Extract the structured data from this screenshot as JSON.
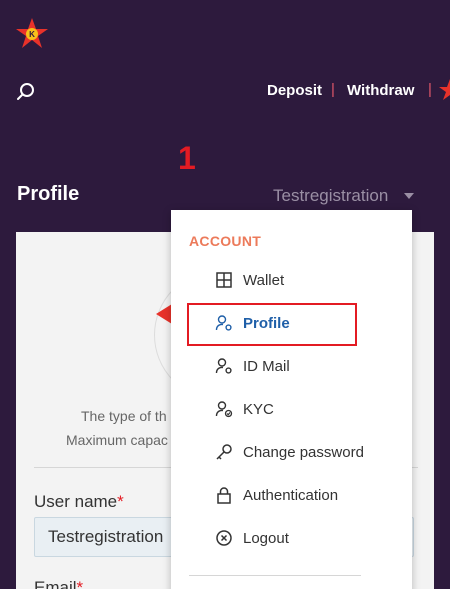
{
  "header": {
    "deposit_label": "Deposit",
    "separator": "|",
    "withdraw_label": "Withdraw"
  },
  "annotation": {
    "step_number": "1"
  },
  "page": {
    "title": "Profile"
  },
  "user_menu": {
    "selected_user": "Testregistration"
  },
  "profile_card": {
    "info_line_1": "The type of th",
    "info_line_2": "Maximum capac",
    "username_label": "User name",
    "username_value": "Testregistration",
    "email_label": "Email",
    "required_mark": "*"
  },
  "dropdown": {
    "heading": "ACCOUNT",
    "items": [
      {
        "label": "Wallet",
        "icon": "wallet-grid-icon"
      },
      {
        "label": "Profile",
        "icon": "user-gear-icon",
        "active": true
      },
      {
        "label": "ID Mail",
        "icon": "user-gear-icon"
      },
      {
        "label": "KYC",
        "icon": "user-check-icon"
      },
      {
        "label": "Change password",
        "icon": "key-icon"
      },
      {
        "label": "Authentication",
        "icon": "lock-icon"
      },
      {
        "label": "Logout",
        "icon": "close-circle-icon"
      }
    ]
  },
  "colors": {
    "background": "#2d1a3d",
    "accent_red": "#e31b23",
    "menu_heading": "#ec7a5a",
    "active_item": "#1f5fa8"
  }
}
